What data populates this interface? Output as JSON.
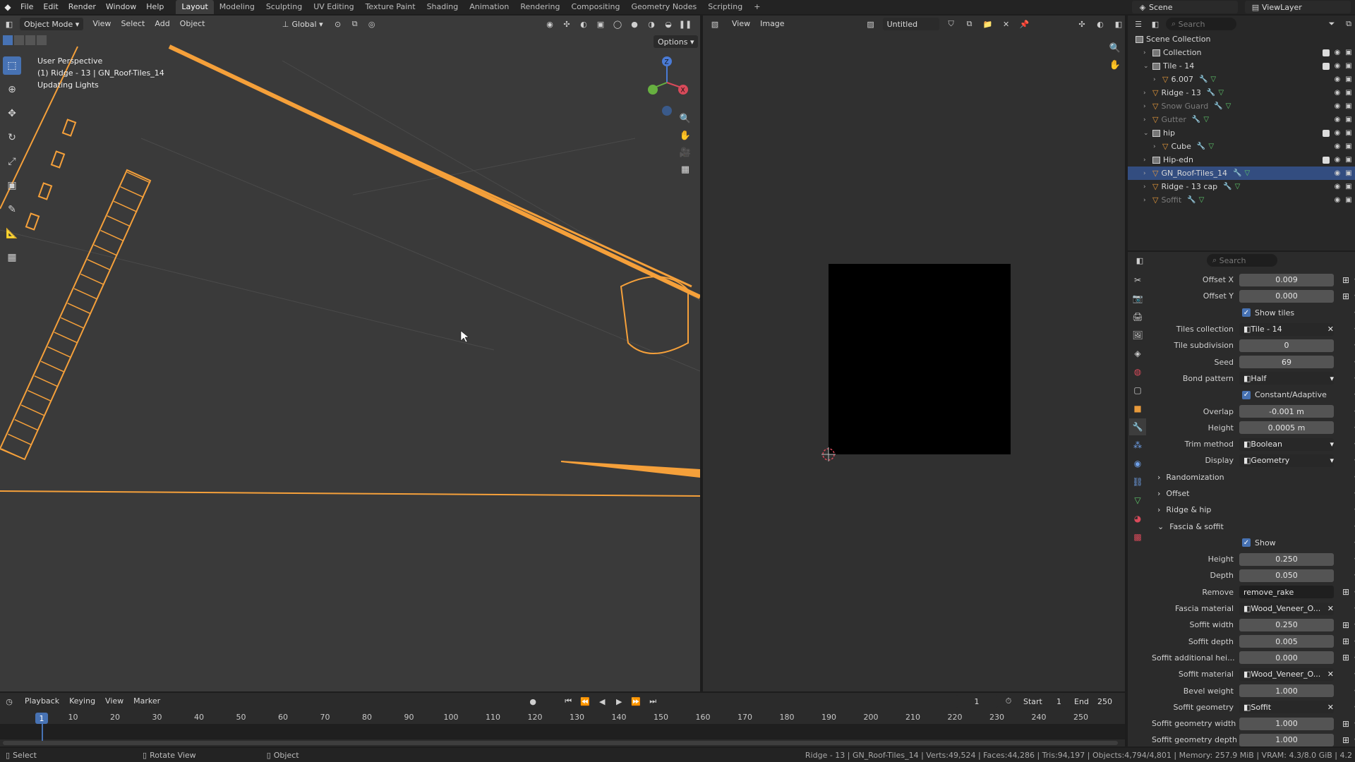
{
  "topbar": {
    "menus": [
      "File",
      "Edit",
      "Render",
      "Window",
      "Help"
    ],
    "workspaces": [
      "Layout",
      "Modeling",
      "Sculpting",
      "UV Editing",
      "Texture Paint",
      "Shading",
      "Animation",
      "Rendering",
      "Compositing",
      "Geometry Nodes",
      "Scripting"
    ],
    "active_workspace": "Layout",
    "scene": "Scene",
    "view_layer": "ViewLayer"
  },
  "viewport": {
    "mode": "Object Mode",
    "menus": [
      "View",
      "Select",
      "Add",
      "Object"
    ],
    "orientation": "Global",
    "options_label": "Options",
    "info_lines": [
      "User Perspective",
      "(1) Ridge - 13 | GN_Roof-Tiles_14",
      "Updating Lights"
    ],
    "wire_color": "#f5a03a"
  },
  "image_editor": {
    "menus": [
      "View",
      "Image"
    ],
    "image_name": "Untitled"
  },
  "outliner": {
    "search_placeholder": "Search",
    "rows": [
      {
        "label": "Scene Collection",
        "type": "scene",
        "indent": 0
      },
      {
        "label": "Collection",
        "type": "collection",
        "indent": 1
      },
      {
        "label": "Tile - 14",
        "type": "collection",
        "indent": 1,
        "expanded": true
      },
      {
        "label": "6.007",
        "type": "object",
        "indent": 2
      },
      {
        "label": "Ridge - 13",
        "type": "object",
        "indent": 1
      },
      {
        "label": "Snow Guard",
        "type": "object",
        "indent": 1,
        "dim": true
      },
      {
        "label": "Gutter",
        "type": "object",
        "indent": 1,
        "dim": true
      },
      {
        "label": "hip",
        "type": "collection",
        "indent": 1,
        "expanded": true
      },
      {
        "label": "Cube",
        "type": "object",
        "indent": 2
      },
      {
        "label": "Hip-edn",
        "type": "collection",
        "indent": 1
      },
      {
        "label": "GN_Roof-Tiles_14",
        "type": "object",
        "indent": 1,
        "selected": true
      },
      {
        "label": "Ridge - 13 cap",
        "type": "object",
        "indent": 1
      },
      {
        "label": "Soffit",
        "type": "object",
        "indent": 1,
        "dim": true
      }
    ]
  },
  "properties": {
    "search_placeholder": "Search",
    "rows": [
      {
        "kind": "field",
        "label": "Offset X",
        "value": "0.009",
        "extra": true
      },
      {
        "kind": "field",
        "label": "Offset Y",
        "value": "0.000",
        "extra": true
      },
      {
        "kind": "check",
        "label": "Show tiles"
      },
      {
        "kind": "dd",
        "label": "Tiles collection",
        "value": "Tile - 14",
        "close": true
      },
      {
        "kind": "field",
        "label": "Tile subdivision",
        "value": "0"
      },
      {
        "kind": "field",
        "label": "Seed",
        "value": "69"
      },
      {
        "kind": "dd",
        "label": "Bond pattern",
        "value": "Half",
        "caret": true
      },
      {
        "kind": "check",
        "label": "Constant/Adaptive"
      },
      {
        "kind": "field",
        "label": "Overlap",
        "value": "-0.001 m"
      },
      {
        "kind": "field",
        "label": "Height",
        "value": "0.0005 m"
      },
      {
        "kind": "dd",
        "label": "Trim method",
        "value": "Boolean",
        "caret": true
      },
      {
        "kind": "dd",
        "label": "Display",
        "value": "Geometry",
        "caret": true
      },
      {
        "kind": "section",
        "label": "Randomization",
        "open": false
      },
      {
        "kind": "section",
        "label": "Offset",
        "open": false
      },
      {
        "kind": "section",
        "label": "Ridge & hip",
        "open": false
      },
      {
        "kind": "section",
        "label": "Fascia & soffit",
        "open": true
      },
      {
        "kind": "check",
        "label": "Show"
      },
      {
        "kind": "field",
        "label": "Height",
        "value": "0.250"
      },
      {
        "kind": "field",
        "label": "Depth",
        "value": "0.050"
      },
      {
        "kind": "dark",
        "label": "Remove",
        "value": "remove_rake",
        "extra": true
      },
      {
        "kind": "dd",
        "label": "Fascia material",
        "value": "Wood_Veneer_O...",
        "close": true
      },
      {
        "kind": "field",
        "label": "Soffit width",
        "value": "0.250",
        "extra": true
      },
      {
        "kind": "field",
        "label": "Soffit depth",
        "value": "0.005",
        "extra": true
      },
      {
        "kind": "field",
        "label": "Soffit additional hei...",
        "value": "0.000",
        "extra": true
      },
      {
        "kind": "dd",
        "label": "Soffit material",
        "value": "Wood_Veneer_O...",
        "close": true
      },
      {
        "kind": "field",
        "label": "Bevel weight",
        "value": "1.000"
      },
      {
        "kind": "dd",
        "label": "Soffit geometry",
        "value": "Soffit",
        "close": true
      },
      {
        "kind": "field",
        "label": "Soffit geometry width",
        "value": "1.000",
        "extra": true
      },
      {
        "kind": "field",
        "label": "Soffit geometry depth",
        "value": "1.000",
        "extra": true
      }
    ]
  },
  "timeline": {
    "menus": [
      "Playback",
      "Keying",
      "View",
      "Marker"
    ],
    "current_frame": "1",
    "start_label": "Start",
    "start": "1",
    "end_label": "End",
    "end": "250",
    "ticks": [
      "1",
      "10",
      "20",
      "30",
      "40",
      "50",
      "60",
      "70",
      "80",
      "90",
      "100",
      "110",
      "120",
      "130",
      "140",
      "150",
      "160",
      "170",
      "180",
      "190",
      "200",
      "210",
      "220",
      "230",
      "240",
      "250"
    ]
  },
  "statusbar": {
    "select": "Select",
    "rotate": "Rotate View",
    "object": "Object",
    "stats": "Ridge - 13 | GN_Roof-Tiles_14 | Verts:49,524 | Faces:44,286 | Tris:94,197 | Objects:4,794/4,801 | Memory: 257.9 MiB | VRAM: 4.3/8.0 GiB | 4.2"
  }
}
